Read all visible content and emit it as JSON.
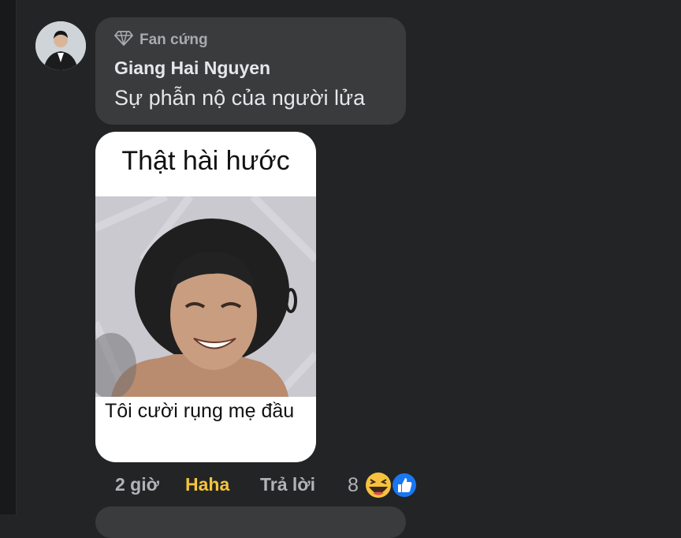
{
  "comment": {
    "badge_label": "Fan cứng",
    "badge_icon": "diamond-icon",
    "author": "Giang Hai Nguyen",
    "text": "Sự phẫn nộ của người lửa"
  },
  "meme": {
    "top_caption": "Thật hài hước",
    "bottom_caption": "Tôi cười rụng mẹ đầu"
  },
  "actions": {
    "time": "2 giờ",
    "reaction_label": "Haha",
    "reply_label": "Trả lời"
  },
  "reactions": {
    "count": "8",
    "icons": [
      "haha-emoji-icon",
      "like-icon"
    ]
  },
  "colors": {
    "background": "#232426",
    "bubble": "#3a3b3c",
    "haha_accent": "#f5c33b",
    "like_blue": "#1877f2"
  }
}
